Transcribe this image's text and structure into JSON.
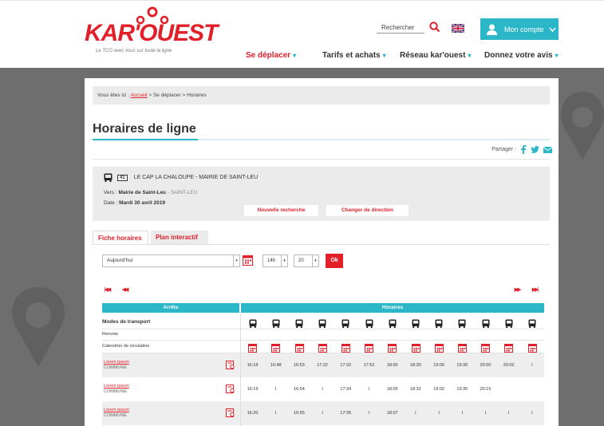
{
  "header": {
    "logo": "KAR'OUEST",
    "tagline": "Le TCO avec vous sur toute la ligne",
    "search_label": "Rechercher",
    "account_label": "Mon compte",
    "nav": [
      "Se déplacer",
      "Tarifs et achats",
      "Réseau kar'ouest",
      "Donnez votre avis"
    ],
    "accent": "#e2202a",
    "teal": "#2bb7c8"
  },
  "breadcrumb": {
    "prefix": "Vous êtes ici :",
    "home": "Accueil",
    "sep": ">",
    "level2": "Se déplacer",
    "current": "Horaires"
  },
  "page": {
    "title": "Horaires de ligne",
    "share_label": "Partager :"
  },
  "line": {
    "number": "41",
    "name": "LE CAP LA CHALOUPE - MAIRIE DE SAINT-LEU",
    "vers_label": "Vers :",
    "vers_value": "Mairie de Saint-Leu",
    "vers_city": "- SAINT-LEU",
    "date_label": "Date :",
    "date_value": "Mardi 30 avril 2019",
    "new_search": "Nouvelle recherche",
    "change_dir": "Changer de direction"
  },
  "tabs": [
    "Fiche horaires",
    "Plan interactif"
  ],
  "controls": {
    "day": "Aujourd'hui",
    "hour": "14h",
    "minute": "20",
    "ok": "Ok"
  },
  "table": {
    "col_stops": "Arrêts",
    "col_times": "Horaires",
    "modes_label": "Modes de transport",
    "renvois_label": "Renvois",
    "calendar_label": "Calendrier de circulation",
    "rows": [
      {
        "name": "Lorem ipsum",
        "commune": "COMMUNE",
        "times": [
          "16:18",
          "16:48",
          "16:53",
          "17:22",
          "17:32",
          "17:52",
          "18:00",
          "18:30",
          "19:00",
          "19:30",
          "20:00",
          "20:02",
          "I"
        ]
      },
      {
        "name": "Lorem ipsum",
        "commune": "COMMUNE",
        "times": [
          "16:19",
          "I",
          "16:54",
          "I",
          "17:34",
          "I",
          "18:05",
          "18:32",
          "19:02",
          "19:35",
          "20:15",
          "",
          ""
        ]
      },
      {
        "name": "Lorem ipsum",
        "commune": "COMMUNE",
        "times": [
          "16:20",
          "I",
          "16:55",
          "I",
          "17:35",
          "I",
          "18:07",
          "I",
          "I",
          "I",
          "I",
          "I",
          "I"
        ]
      }
    ]
  }
}
